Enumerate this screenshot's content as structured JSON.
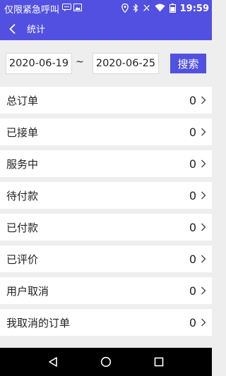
{
  "status_bar": {
    "left_text": "仅限紧急呼叫",
    "time": "19:59",
    "icons": [
      "message-icon",
      "image-icon",
      "location-icon",
      "bluetooth-icon",
      "mute-icon",
      "wifi-icon",
      "battery-icon"
    ]
  },
  "app_bar": {
    "title": "统计",
    "back_icon": "chevron-left-icon"
  },
  "filter": {
    "start_date": "2020-06-19",
    "separator": "~",
    "end_date": "2020-06-25",
    "search_label": "搜索"
  },
  "stats": [
    {
      "label": "总订单",
      "value": "0"
    },
    {
      "label": "已接单",
      "value": "0"
    },
    {
      "label": "服务中",
      "value": "0"
    },
    {
      "label": "待付款",
      "value": "0"
    },
    {
      "label": "已付款",
      "value": "0"
    },
    {
      "label": "已评价",
      "value": "0"
    },
    {
      "label": "用户取消",
      "value": "0"
    },
    {
      "label": "我取消的订单",
      "value": "0"
    }
  ],
  "colors": {
    "primary": "#5250e0",
    "background": "#eeeeee",
    "row": "#ffffff",
    "nav": "#000000"
  }
}
